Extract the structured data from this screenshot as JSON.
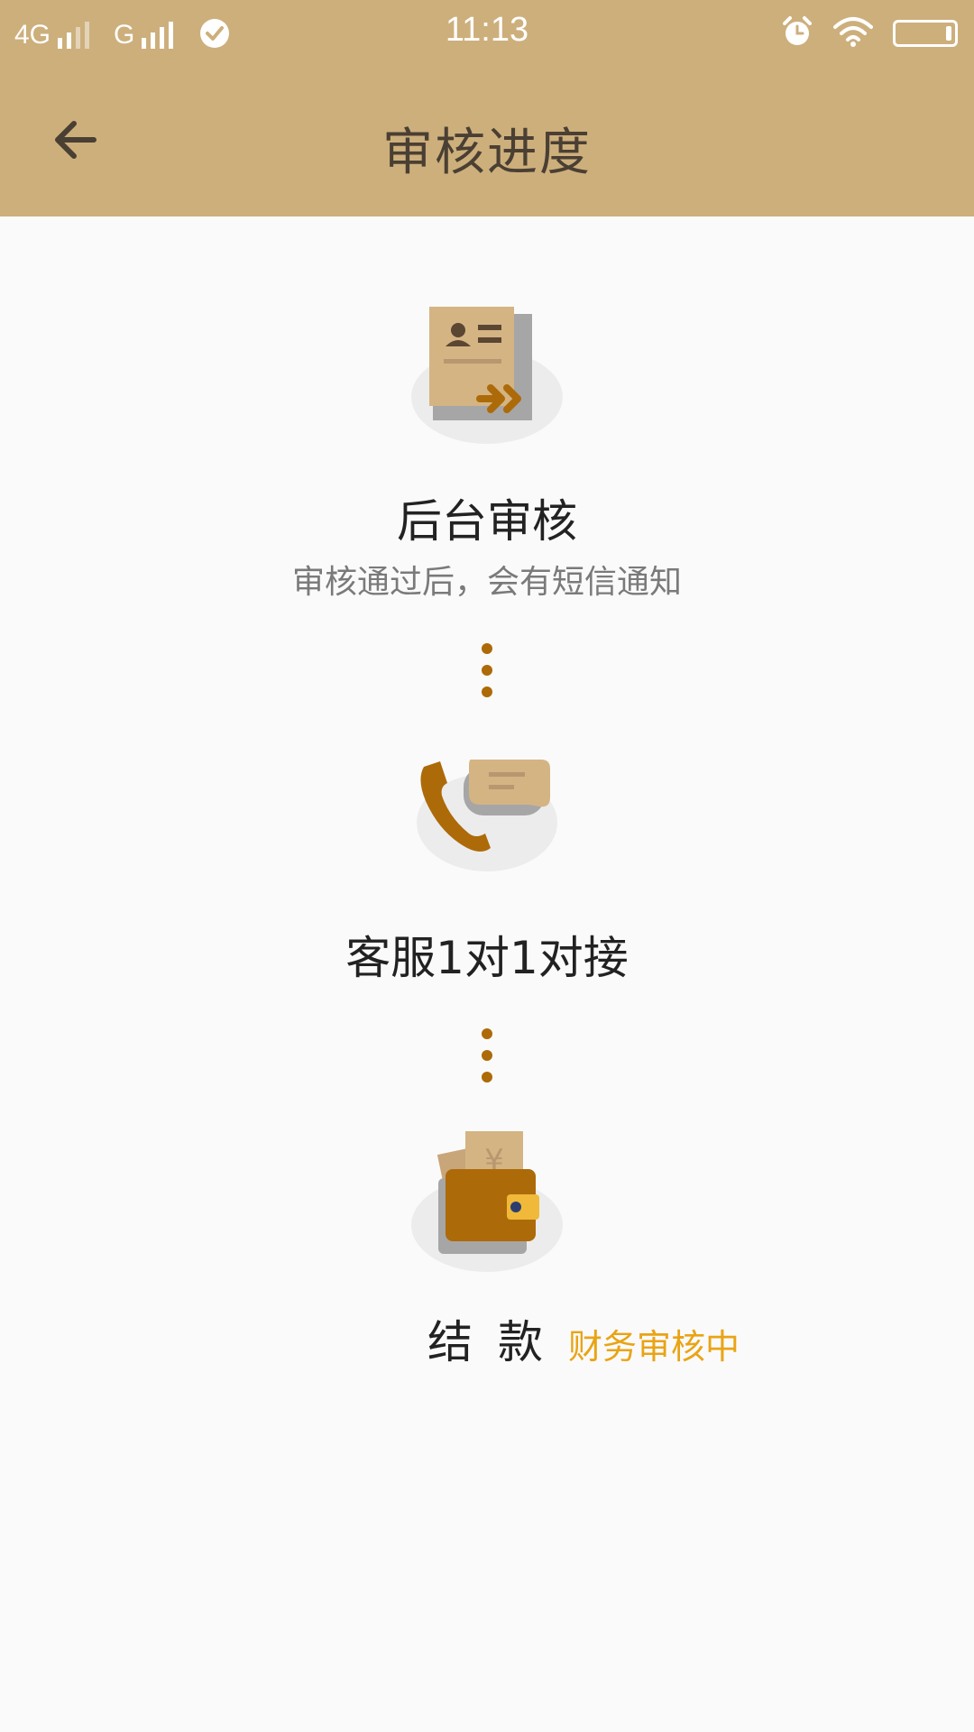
{
  "statusbar": {
    "network_1": "4G",
    "network_2": "G",
    "time": "11:13",
    "icons": [
      "signal-icon",
      "check-circle-icon",
      "alarm-icon",
      "wifi-icon",
      "battery-icon"
    ]
  },
  "header": {
    "title": "审核进度",
    "back_icon": "arrow-left-icon",
    "background_color": "#cdaf7c"
  },
  "steps": [
    {
      "icon": "document-transfer-icon",
      "title": "后台审核",
      "subtitle": "审核通过后，会有短信通知"
    },
    {
      "icon": "phone-chat-icon",
      "title": "客服1对1对接"
    },
    {
      "icon": "wallet-icon",
      "title": "结款",
      "status": "财务审核中"
    }
  ],
  "colors": {
    "accent": "#ad6a09",
    "status": "#e9a415",
    "icon_beige": "#d4b483"
  }
}
